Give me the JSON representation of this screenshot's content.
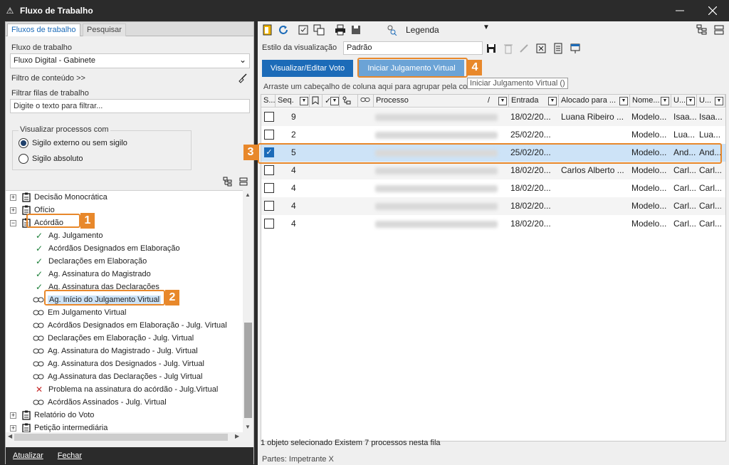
{
  "window": {
    "title": "Fluxo de Trabalho"
  },
  "left": {
    "tabs": [
      "Fluxos de trabalho",
      "Pesquisar"
    ],
    "workflow_label": "Fluxo de trabalho",
    "workflow_value": "Fluxo Digital - Gabinete",
    "content_filter_label": "Filtro de conteúdo >>",
    "queue_filter_label": "Filtrar filas de trabalho",
    "queue_filter_placeholder": "Digite o texto para filtrar...",
    "view_group_title": "Visualizar processos com",
    "radio_options": [
      "Sigilo externo ou sem sigilo",
      "Sigilo absoluto"
    ],
    "tree": [
      {
        "label": "Decisão Monocrática",
        "type": "folder"
      },
      {
        "label": "Ofício",
        "type": "folder"
      },
      {
        "label": "Acórdão",
        "type": "folder-open"
      },
      {
        "label": "Ag. Julgamento",
        "type": "check"
      },
      {
        "label": "Acórdãos Designados em Elaboração",
        "type": "check"
      },
      {
        "label": "Declarações em Elaboração",
        "type": "check"
      },
      {
        "label": "Ag. Assinatura do Magistrado",
        "type": "check"
      },
      {
        "label": "Ag. Assinatura das Declarações",
        "type": "check"
      },
      {
        "label": "Ag. Início do Julgamento Virtual",
        "type": "link"
      },
      {
        "label": "Em Julgamento Virtual",
        "type": "link"
      },
      {
        "label": "Acórdãos Designados em Elaboração - Julg. Virtual",
        "type": "link"
      },
      {
        "label": "Declarações em Elaboração - Julg. Virtual",
        "type": "link"
      },
      {
        "label": "Ag. Assinatura do Magistrado - Julg. Virtual",
        "type": "link"
      },
      {
        "label": "Ag. Assinatura dos Designados - Julg. Virtual",
        "type": "link"
      },
      {
        "label": "Ag.Assinatura das Declarações - Julg Virtual",
        "type": "link"
      },
      {
        "label": "Problema na assinatura do acórdão - Julg.Virtual",
        "type": "x"
      },
      {
        "label": "Acórdãos Assinados - Julg. Virtual",
        "type": "link"
      },
      {
        "label": "Relatório do Voto",
        "type": "folder"
      },
      {
        "label": "Petição intermediária",
        "type": "folder"
      }
    ],
    "footer": [
      "Atualizar",
      "Fechar"
    ]
  },
  "right": {
    "legend_label": "Legenda",
    "view_style_label": "Estilo da visualização",
    "view_style_value": "Padrão",
    "btn_edit_vote": "Visualizar/Editar Voto",
    "btn_start_virtual": "Iniciar Julgamento Virtual",
    "tooltip": "Iniciar Julgamento Virtual ()",
    "group_hint": "Arraste um cabeçalho de coluna aqui para agrupar pela coluna",
    "columns": [
      "S...",
      "Seq.",
      "",
      "",
      "",
      "",
      "Processo",
      "/",
      "Entrada",
      "Alocado para ...",
      "Nome...",
      "U...",
      "U..."
    ],
    "rows": [
      {
        "seq": "9",
        "entrada": "18/02/20...",
        "alocado": "Luana Ribeiro ...",
        "nome": "Modelo...",
        "u1": "Isaa...",
        "u2": "Isaa...",
        "checked": false
      },
      {
        "seq": "2",
        "entrada": "25/02/20...",
        "alocado": "",
        "nome": "Modelo...",
        "u1": "Lua...",
        "u2": "Lua...",
        "checked": false
      },
      {
        "seq": "5",
        "entrada": "25/02/20...",
        "alocado": "",
        "nome": "Modelo...",
        "u1": "And...",
        "u2": "And...",
        "checked": true
      },
      {
        "seq": "4",
        "entrada": "18/02/20...",
        "alocado": "Carlos Alberto ...",
        "nome": "Modelo...",
        "u1": "Carl...",
        "u2": "Carl...",
        "checked": false
      },
      {
        "seq": "4",
        "entrada": "18/02/20...",
        "alocado": "",
        "nome": "Modelo...",
        "u1": "Carl...",
        "u2": "Carl...",
        "checked": false
      },
      {
        "seq": "4",
        "entrada": "18/02/20...",
        "alocado": "",
        "nome": "Modelo...",
        "u1": "Carl...",
        "u2": "Carl...",
        "checked": false
      },
      {
        "seq": "4",
        "entrada": "18/02/20...",
        "alocado": "",
        "nome": "Modelo...",
        "u1": "Carl...",
        "u2": "Carl...",
        "checked": false
      }
    ],
    "status": "1 objeto selecionado   Existem 7 processos nesta fila",
    "parts": "Partes: Impetrante X"
  },
  "callouts": [
    "1",
    "2",
    "3",
    "4"
  ],
  "colors": {
    "accent": "#1c6bb8",
    "callout": "#e8882b",
    "selection": "#cde3f7"
  }
}
